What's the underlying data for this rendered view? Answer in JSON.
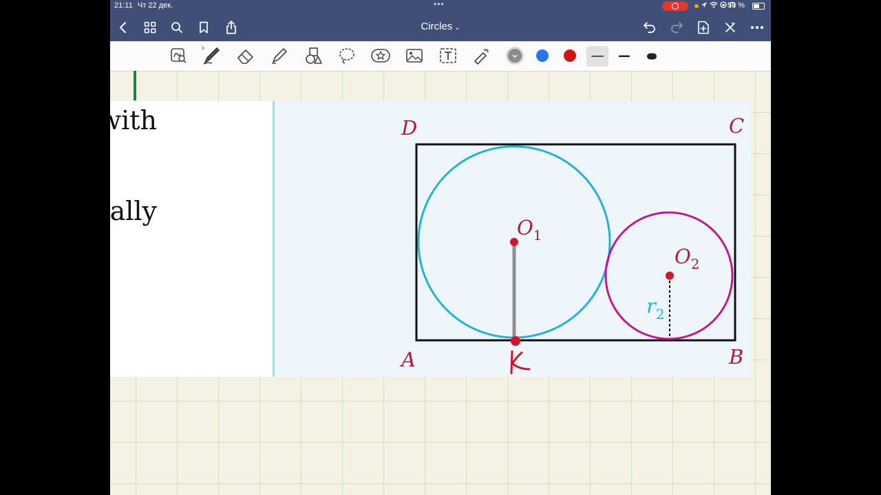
{
  "status_bar": {
    "time": "21:11",
    "date": "Чт 22 дек.",
    "dots": "•••",
    "battery_percent": "58 %"
  },
  "nav": {
    "title": "Circles"
  },
  "colors": {
    "toolbar_blue": "#2478f0",
    "toolbar_red": "#d31414",
    "toolbar_gray": "#8c8c8c",
    "circle1": "#1fb3d6",
    "circle2": "#c0188d",
    "point": "#d1152c",
    "label": "#b01a3a",
    "r2_label": "#1fb3d6"
  },
  "icons": {
    "back": "chevron-left-icon",
    "grid": "grid-icon",
    "search": "search-icon",
    "bookmark": "bookmark-icon",
    "share": "share-icon",
    "undo": "undo-icon",
    "redo": "redo-icon",
    "add_page": "add-page-icon",
    "close": "close-icon",
    "more": "more-icon"
  },
  "left_text": {
    "line1": "with",
    "line2": "ally"
  },
  "figure": {
    "labels": {
      "D": "D",
      "C": "C",
      "A": "A",
      "B": "B",
      "O1_base": "O",
      "O1_sub": "1",
      "O2_base": "O",
      "O2_sub": "2",
      "r2_base": "r",
      "r2_sub": "2"
    },
    "handwritten_K": "K"
  }
}
